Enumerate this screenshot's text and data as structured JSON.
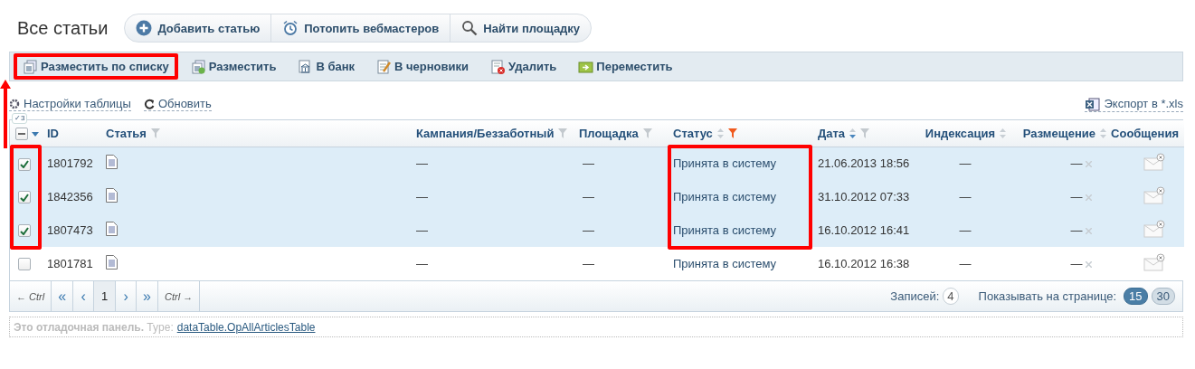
{
  "page_title": "Все статьи",
  "top_buttons": [
    {
      "kind": "add",
      "label": "Добавить статью"
    },
    {
      "kind": "alarm",
      "label": "Потопить вебмастеров"
    },
    {
      "kind": "search",
      "label": "Найти площадку"
    }
  ],
  "toolbar": [
    {
      "kind": "list",
      "label": "Разместить по списку",
      "marked": true
    },
    {
      "kind": "place",
      "label": "Разместить",
      "marked": false
    },
    {
      "kind": "bank",
      "label": "В банк",
      "marked": false
    },
    {
      "kind": "draft",
      "label": "В черновики",
      "marked": false
    },
    {
      "kind": "delete",
      "label": "Удалить",
      "marked": false
    },
    {
      "kind": "move",
      "label": "Переместить",
      "marked": false
    }
  ],
  "annotation_arrow": true,
  "links": {
    "settings": "Настройки таблицы",
    "refresh": "Обновить",
    "export": "Экспорт в *.xls"
  },
  "selected_badge": "✓3",
  "select_all_partial": true,
  "table": {
    "columns": [
      {
        "label": "ID",
        "sortable": false,
        "filter": false
      },
      {
        "label": "Статья",
        "sortable": false,
        "filter": true,
        "filter_active": false
      },
      {
        "label": "Кампания/Беззаботный",
        "sortable": false,
        "filter": true,
        "filter_active": false
      },
      {
        "label": "Площадка",
        "sortable": false,
        "filter": true,
        "filter_active": false
      },
      {
        "label": "Статус",
        "sortable": true,
        "sorted_desc": false,
        "filter": true,
        "filter_active": true
      },
      {
        "label": "Дата",
        "sortable": true,
        "sorted_desc": true,
        "filter": true,
        "filter_active": false
      },
      {
        "label": "Индексация",
        "sortable": true,
        "sorted_desc": false,
        "filter": false
      },
      {
        "label": "Размещение",
        "sortable": true,
        "sorted_desc": false,
        "filter": false
      },
      {
        "label": "Сообщения",
        "sortable": false,
        "filter": false
      }
    ],
    "rows": [
      {
        "checked": true,
        "marked": true,
        "id": "1801792",
        "campaign": "—",
        "site": "—",
        "status": "Принята в систему",
        "date": "21.06.2013 18:56",
        "indexing": "—",
        "placement": "—"
      },
      {
        "checked": true,
        "marked": true,
        "id": "1842356",
        "campaign": "—",
        "site": "—",
        "status": "Принята в систему",
        "date": "31.10.2012 07:33",
        "indexing": "—",
        "placement": "—"
      },
      {
        "checked": true,
        "marked": true,
        "id": "1807473",
        "campaign": "—",
        "site": "—",
        "status": "Принята в систему",
        "date": "16.10.2012 16:41",
        "indexing": "—",
        "placement": "—"
      },
      {
        "checked": false,
        "marked": false,
        "id": "1801781",
        "campaign": "—",
        "site": "—",
        "status": "Принята в систему",
        "date": "16.10.2012 16:38",
        "indexing": "—",
        "placement": "—"
      }
    ]
  },
  "pager": {
    "prev_hint": "← Ctrl",
    "next_hint": "Ctrl →",
    "buttons": [
      {
        "label": "«",
        "selected": false
      },
      {
        "label": "‹",
        "selected": false
      },
      {
        "label": "1",
        "selected": true
      },
      {
        "label": "›",
        "selected": false
      },
      {
        "label": "»",
        "selected": false
      }
    ],
    "records_label": "Записей:",
    "records_count": "4",
    "per_page_label": "Показывать на странице:",
    "per_page": [
      {
        "label": "15",
        "selected": true
      },
      {
        "label": "30",
        "selected": false
      }
    ]
  },
  "debug": {
    "text": "**Это отладочная панель.** Type:",
    "link": "dataTable.OpAllArticlesTable"
  }
}
